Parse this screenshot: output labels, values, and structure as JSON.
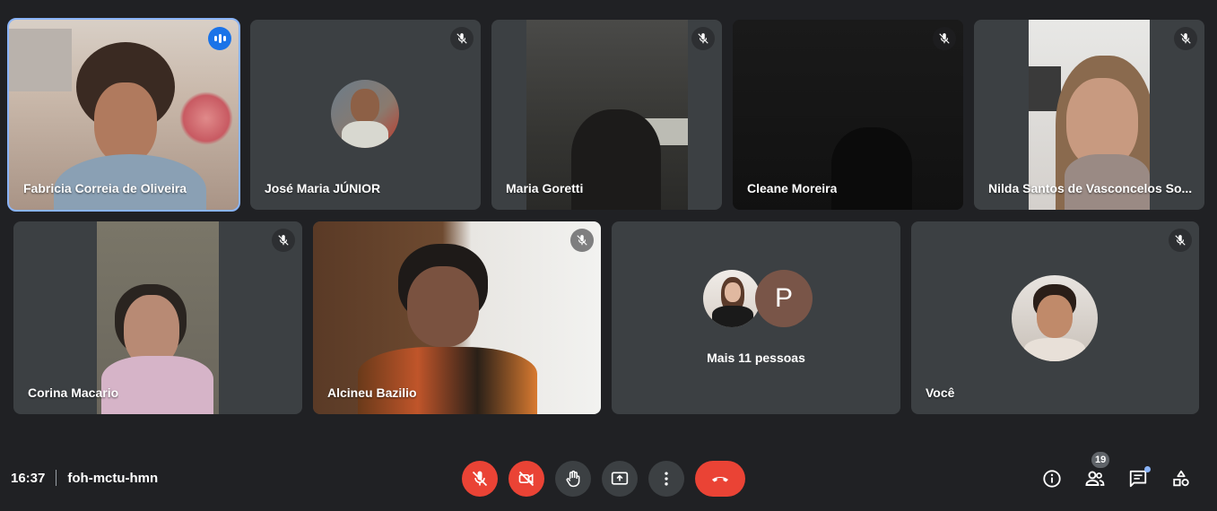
{
  "participants_row1": [
    {
      "name": "Fabricia Correia de Oliveira",
      "speaking": true
    },
    {
      "name": "José Maria JÚNIOR",
      "muted": true
    },
    {
      "name": "Maria Goretti",
      "muted": true
    },
    {
      "name": "Cleane Moreira",
      "muted": true
    },
    {
      "name": "Nilda Santos de Vasconcelos So...",
      "muted": true
    }
  ],
  "participants_row2": [
    {
      "name": "Corina Macario",
      "muted": true
    },
    {
      "name": "Alcineu Bazilio",
      "muted": true
    },
    {
      "name": "Mais 11 pessoas",
      "avatar_letter": "P"
    },
    {
      "name": "Você",
      "muted": true
    }
  ],
  "bottombar": {
    "time": "16:37",
    "meeting_code": "foh-mctu-hmn",
    "people_count": "19"
  },
  "colors": {
    "background": "#202124",
    "tile": "#3c4043",
    "red": "#ea4335",
    "active_border": "#8ab4f8",
    "speaking_blue": "#1a73e8"
  }
}
